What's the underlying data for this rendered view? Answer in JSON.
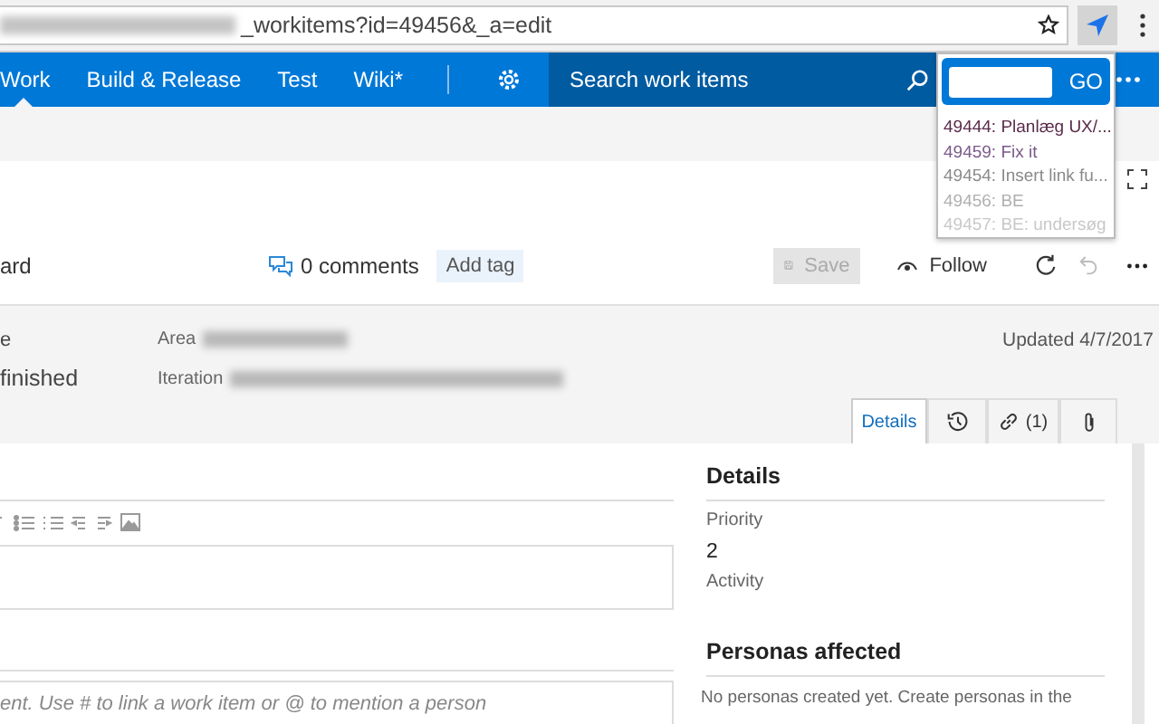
{
  "browser": {
    "url": "_workitems?id=49456&_a=edit"
  },
  "nav": {
    "items": [
      {
        "label": "Work",
        "selected": true
      },
      {
        "label": "Build & Release",
        "selected": false
      },
      {
        "label": "Test",
        "selected": false
      },
      {
        "label": "Wiki*",
        "selected": false
      }
    ],
    "search_placeholder": "Search work items"
  },
  "popup": {
    "button": "GO",
    "items": [
      {
        "label": "49444: Planlæg UX/...",
        "color": "#5a2a4a"
      },
      {
        "label": "49459: Fix it",
        "color": "#7a5a8a"
      },
      {
        "label": "49454: Insert link fu...",
        "color": "#8a8a8a"
      },
      {
        "label": "49456: BE",
        "color": "#b0b0b0"
      },
      {
        "label": "49457: BE: undersøg",
        "color": "#c8c8c8"
      }
    ]
  },
  "toolbar": {
    "board": "ard",
    "comments": "0 comments",
    "add_tag": "Add tag",
    "save": "Save",
    "follow": "Follow"
  },
  "header": {
    "state_label": "e",
    "state_value": "finished",
    "area_label": "Area",
    "iteration_label": "Iteration",
    "updated": "Updated 4/7/2017"
  },
  "tabs": [
    {
      "kind": "text",
      "label": "Details",
      "selected": true
    },
    {
      "kind": "history",
      "selected": false
    },
    {
      "kind": "links",
      "label": "(1)",
      "selected": false
    },
    {
      "kind": "attachments",
      "selected": false
    }
  ],
  "comment_placeholder": "ent. Use # to link a work item or @ to mention a person",
  "details": {
    "title": "Details",
    "priority_label": "Priority",
    "priority": "2",
    "activity_label": "Activity"
  },
  "personas": {
    "title": "Personas affected",
    "text": "No personas created yet. Create personas in the"
  }
}
